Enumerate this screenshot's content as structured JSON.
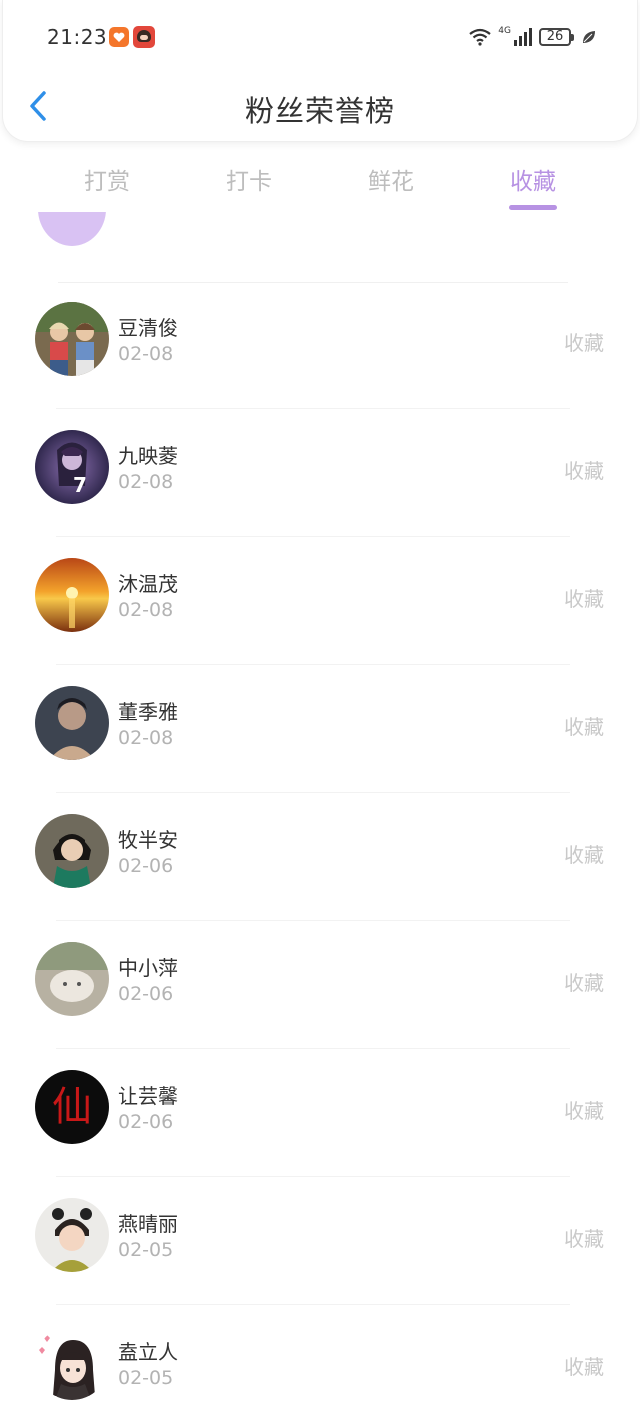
{
  "status_bar": {
    "time": "21:23",
    "network": "4G",
    "battery": "26"
  },
  "header": {
    "title": "粉丝荣誉榜"
  },
  "tabs": [
    {
      "label": "打赏",
      "active": false
    },
    {
      "label": "打卡",
      "active": false
    },
    {
      "label": "鲜花",
      "active": false
    },
    {
      "label": "收藏",
      "active": true
    }
  ],
  "colors": {
    "accent": "#b792e3",
    "back_arrow": "#2f8fe8"
  },
  "list": [
    {
      "name": "豆清俊",
      "date": "02-08",
      "action": "收藏",
      "avatar": "two-kids-photo"
    },
    {
      "name": "九映菱",
      "date": "02-08",
      "action": "收藏",
      "avatar": "anime-girl-7"
    },
    {
      "name": "沐温茂",
      "date": "02-08",
      "action": "收藏",
      "avatar": "sunset-sea"
    },
    {
      "name": "董季雅",
      "date": "02-08",
      "action": "收藏",
      "avatar": "dark-portrait"
    },
    {
      "name": "牧半安",
      "date": "02-06",
      "action": "收藏",
      "avatar": "boy-green-scarf"
    },
    {
      "name": "中小萍",
      "date": "02-06",
      "action": "收藏",
      "avatar": "fluffy-animal"
    },
    {
      "name": "让芸馨",
      "date": "02-06",
      "action": "收藏",
      "avatar": "red-calligraphy"
    },
    {
      "name": "燕晴丽",
      "date": "02-05",
      "action": "收藏",
      "avatar": "girl-bows"
    },
    {
      "name": "盍立人",
      "date": "02-05",
      "action": "收藏",
      "avatar": "cartoon-girl-hearts"
    }
  ],
  "avatar_text": {
    "anime_number": "7",
    "calligraphy": "仙"
  }
}
